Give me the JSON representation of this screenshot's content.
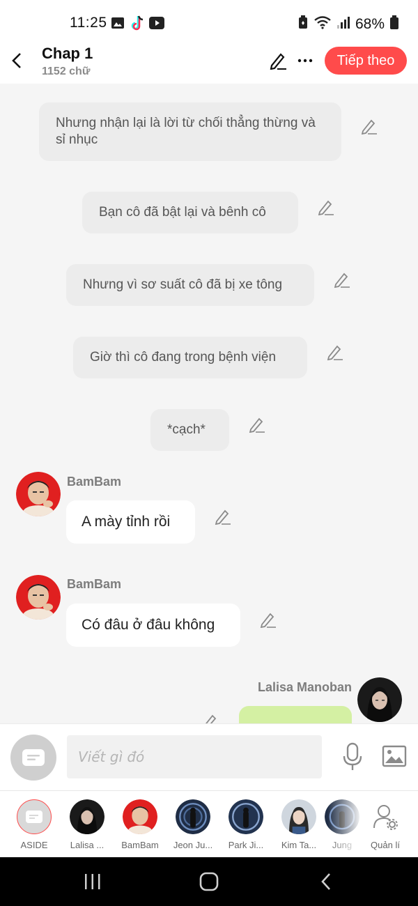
{
  "status": {
    "time": "11:25",
    "battery": "68%",
    "icons_left": [
      "gallery-icon",
      "tiktok-icon",
      "youtube-icon"
    ],
    "icons_right": [
      "battery-saver-icon",
      "wifi-icon",
      "signal-icon",
      "battery-icon"
    ]
  },
  "header": {
    "title": "Chap 1",
    "word_count": "1152 chữ",
    "next_label": "Tiếp theo",
    "accent_color": "#ff4b4b"
  },
  "narrations": [
    {
      "text": "Nhưng nhận lại là lời từ chối thẳng thừng và sỉ nhục"
    },
    {
      "text": "Bạn cô đã bật lại và bênh cô"
    },
    {
      "text": "Nhưng vì sơ suất cô đã bị xe tông"
    },
    {
      "text": "Giờ thì cô đang trong bệnh viện"
    },
    {
      "text": "*cạch*"
    }
  ],
  "messages": [
    {
      "sender": "BamBam",
      "text": "A mày tỉnh rồi"
    },
    {
      "sender": "BamBam",
      "text": "Có đâu ở đâu không"
    },
    {
      "sender": "Lalisa Manoban",
      "text": "",
      "bubble_color": "#d4f0a3"
    }
  ],
  "composer": {
    "placeholder": "Viết gì đó"
  },
  "characters": [
    {
      "name": "ASIDE"
    },
    {
      "name": "Lalisa ..."
    },
    {
      "name": "BamBam"
    },
    {
      "name": "Jeon Ju..."
    },
    {
      "name": "Park Ji..."
    },
    {
      "name": "Kim Ta..."
    },
    {
      "name": "Jung"
    },
    {
      "name": "Quản lí"
    }
  ]
}
